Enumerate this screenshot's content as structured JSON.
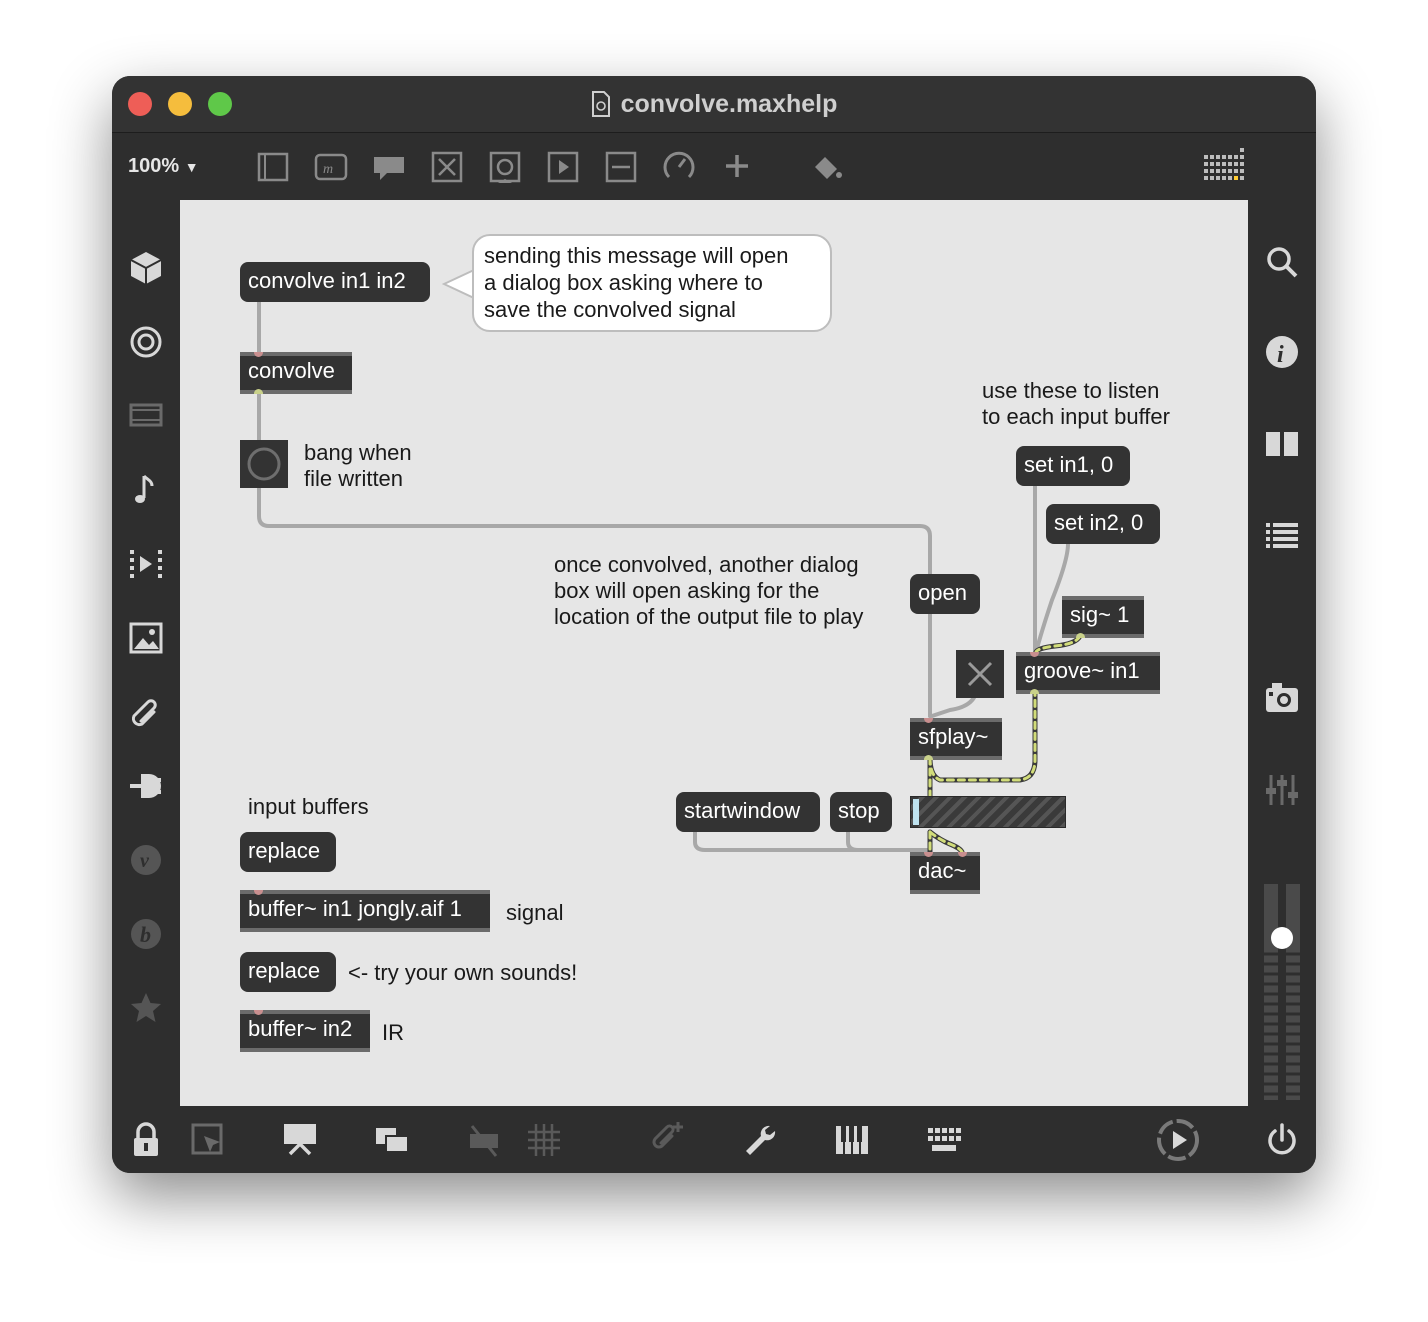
{
  "window": {
    "title": "convolve.maxhelp"
  },
  "toolbar": {
    "zoom": "100%",
    "icons": [
      "presentation-frame-icon",
      "message-icon",
      "comment-icon",
      "toggle-icon",
      "button-icon",
      "playbar-icon",
      "slider-icon",
      "dial-icon",
      "add-object-icon",
      "format-paint-icon",
      "grid-icon"
    ]
  },
  "left_sidebar": {
    "icons": [
      "package-icon",
      "target-icon",
      "media-icon",
      "music-icon",
      "clip-icon",
      "image-icon",
      "paperclip-icon",
      "plug-icon",
      "vst-icon",
      "bpatcher-icon",
      "favorites-icon"
    ]
  },
  "right_sidebar": {
    "icons": [
      "search-icon",
      "info-icon",
      "reference-icon",
      "list-icon",
      "snapshot-icon",
      "mixer-icon",
      "volume-slider-icon"
    ]
  },
  "bottom_bar": {
    "icons": [
      "lock-icon",
      "select-icon",
      "presentation-icon",
      "windows-icon",
      "hide-icon",
      "grid-snap-icon",
      "attach-icon",
      "wrench-icon",
      "piano-icon",
      "keyboard-icon",
      "transport-icon",
      "power-icon"
    ]
  },
  "patch": {
    "convolve_msg": "convolve in1 in2",
    "bubble": [
      "sending this message will open",
      "a dialog box asking where to",
      "save the convolved signal"
    ],
    "convolve_obj": "convolve",
    "bang_comment": [
      "bang when",
      "file written"
    ],
    "listen_comment": [
      "use these to listen",
      "to each input buffer"
    ],
    "set_in1": "set in1, 0",
    "set_in2": "set in2, 0",
    "once_comment": [
      "once convolved, another dialog",
      "box will open asking for the",
      "location of the output file to play"
    ],
    "open_msg": "open",
    "sig_obj": "sig~ 1",
    "groove_obj": "groove~ in1",
    "sfplay_obj": "sfplay~",
    "input_buffers_comment": "input buffers",
    "replace1": "replace",
    "buffer1": "buffer~ in1 jongly.aif 1",
    "signal_comment": "signal",
    "replace2": "replace",
    "try_comment": "<- try your own sounds!",
    "buffer2": "buffer~ in2",
    "ir_comment": "IR",
    "startwindow": "startwindow",
    "stop": "stop",
    "dac_obj": "dac~"
  }
}
